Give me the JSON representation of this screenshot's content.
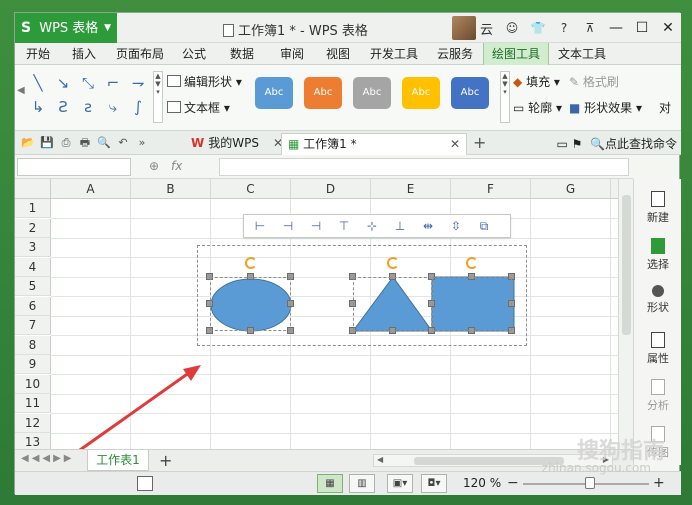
{
  "app": {
    "name": "WPS 表格",
    "logo": "S",
    "doc_title": "工作簿1 * - WPS 表格",
    "user": "云"
  },
  "ribbon_tabs": [
    "开始",
    "插入",
    "页面布局",
    "公式",
    "数据",
    "审阅",
    "视图",
    "开发工具",
    "云服务",
    "绘图工具",
    "文本工具"
  ],
  "active_tab": "绘图工具",
  "ribbon": {
    "edit_shape": "编辑形状",
    "textbox": "文本框",
    "style_label": "Abc",
    "style_colors": [
      "#5b9bd5",
      "#ed7d31",
      "#a5a5a5",
      "#ffc000",
      "#4472c4"
    ],
    "fill": "填充",
    "format_brush": "格式刷",
    "outline": "轮廓",
    "shape_effects": "形状效果",
    "align_partial": "对"
  },
  "doc_tabs": {
    "my_wps": "我的WPS",
    "workbook": "工作簿1 *",
    "find_command": "点此查找命令"
  },
  "formula": {
    "fx": "fx"
  },
  "columns": [
    "A",
    "B",
    "C",
    "D",
    "E",
    "F",
    "G"
  ],
  "rows": [
    "1",
    "2",
    "3",
    "4",
    "5",
    "6",
    "7",
    "8",
    "9",
    "10",
    "11",
    "12",
    "13"
  ],
  "side_panel": [
    {
      "label": "新建",
      "icon": "new-doc-icon"
    },
    {
      "label": "选择",
      "icon": "select-icon"
    },
    {
      "label": "形状",
      "icon": "shape-icon"
    },
    {
      "label": "属性",
      "icon": "property-icon"
    },
    {
      "label": "分析",
      "icon": "analyze-icon"
    },
    {
      "label": "传图",
      "icon": "upload-image-icon"
    }
  ],
  "sheet_tab": "工作表1",
  "status": {
    "zoom": "120 %"
  },
  "watermark": {
    "brand": "搜狗指南",
    "url": "zhinan.sogou.com"
  },
  "colors": {
    "shape_fill": "#5b9bd5",
    "shape_stroke": "#41719c",
    "accent": "#2e9b3a",
    "arrow": "#e03a3a"
  }
}
